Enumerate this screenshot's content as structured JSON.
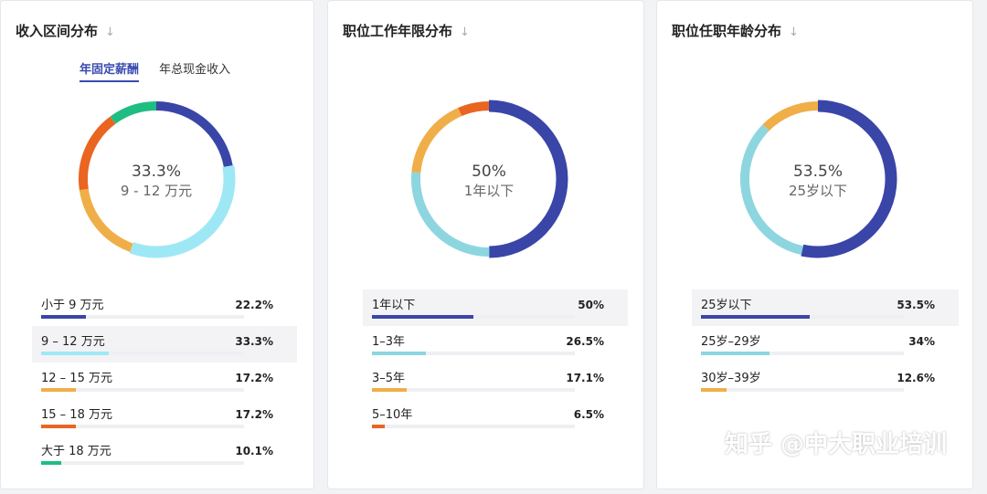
{
  "panels": [
    {
      "title": "收入区间分布",
      "tabs": [
        {
          "label": "年固定薪酬",
          "active": true
        },
        {
          "label": "年总现金收入",
          "active": false
        }
      ],
      "center_pct": "33.3%",
      "center_label": "9 - 12 万元",
      "highlight_index": 1,
      "segments_order": [
        0,
        1,
        2,
        3,
        4
      ],
      "rows": [
        {
          "label": "小于 9 万元",
          "value": "22.2%",
          "color": "#3a45a8"
        },
        {
          "label": "9 – 12 万元",
          "value": "33.3%",
          "color": "#9ee8f5"
        },
        {
          "label": "12 – 15 万元",
          "value": "17.2%",
          "color": "#f0ae48"
        },
        {
          "label": "15 – 18 万元",
          "value": "17.2%",
          "color": "#e96520"
        },
        {
          "label": "大于 18 万元",
          "value": "10.1%",
          "color": "#1fbd82"
        }
      ]
    },
    {
      "title": "职位工作年限分布",
      "tabs": [],
      "center_pct": "50%",
      "center_label": "1年以下",
      "highlight_index": 0,
      "rows": [
        {
          "label": "1年以下",
          "value": "50%",
          "color": "#3a45a8"
        },
        {
          "label": "1–3年",
          "value": "26.5%",
          "color": "#8dd6e0"
        },
        {
          "label": "3–5年",
          "value": "17.1%",
          "color": "#f0ae48"
        },
        {
          "label": "5–10年",
          "value": "6.5%",
          "color": "#e96520"
        }
      ]
    },
    {
      "title": "职位任职年龄分布",
      "tabs": [],
      "center_pct": "53.5%",
      "center_label": "25岁以下",
      "highlight_index": 0,
      "rows": [
        {
          "label": "25岁以下",
          "value": "53.5%",
          "color": "#3a45a8"
        },
        {
          "label": "25岁–29岁",
          "value": "34%",
          "color": "#8dd6e0"
        },
        {
          "label": "30岁–39岁",
          "value": "12.6%",
          "color": "#f0ae48"
        }
      ]
    }
  ],
  "watermark": "知乎 @中大职业培训",
  "chart_data": [
    {
      "type": "pie",
      "title": "收入区间分布",
      "categories": [
        "小于 9 万元",
        "9 – 12 万元",
        "12 – 15 万元",
        "15 – 18 万元",
        "大于 18 万元"
      ],
      "values": [
        22.2,
        33.3,
        17.2,
        17.2,
        10.1
      ]
    },
    {
      "type": "pie",
      "title": "职位工作年限分布",
      "categories": [
        "1年以下",
        "1–3年",
        "3–5年",
        "5–10年"
      ],
      "values": [
        50,
        26.5,
        17.1,
        6.5
      ]
    },
    {
      "type": "pie",
      "title": "职位任职年龄分布",
      "categories": [
        "25岁以下",
        "25岁–29岁",
        "30岁–39岁"
      ],
      "values": [
        53.5,
        34,
        12.6
      ]
    }
  ]
}
